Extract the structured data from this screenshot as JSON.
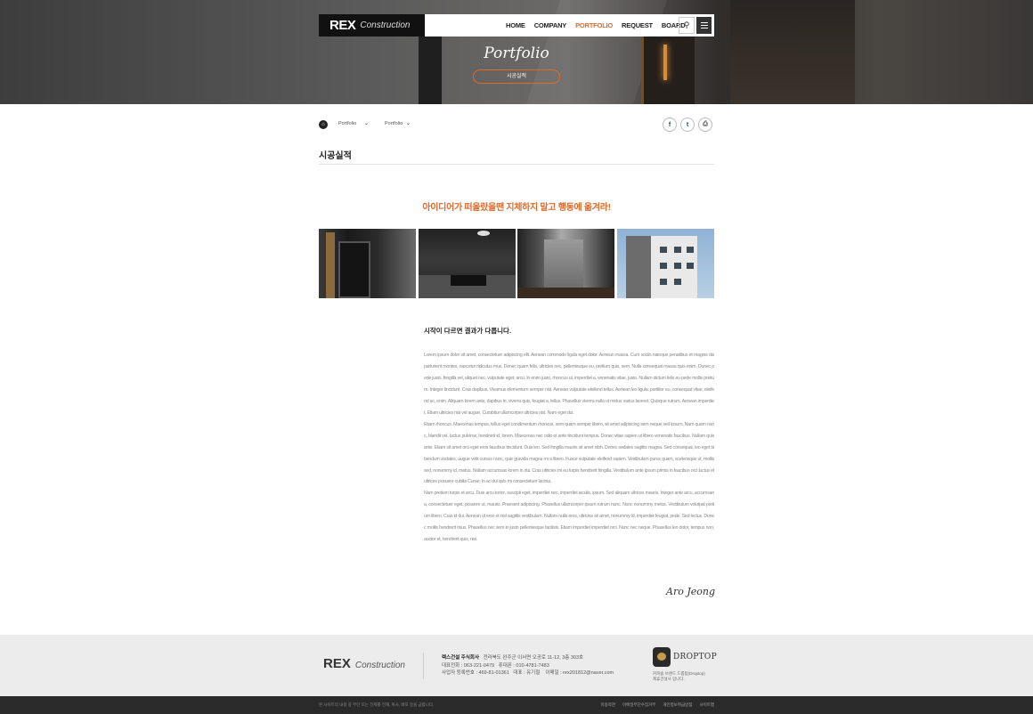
{
  "header": {
    "logo_main": "REX",
    "logo_sub": "Construction",
    "menu": [
      "HOME",
      "COMPANY",
      "PORTFOLIO",
      "REQUEST",
      "BOARD"
    ],
    "active_menu": "PORTFOLIO",
    "search_icon": "search-icon",
    "menu_icon": "hamburger-icon"
  },
  "hero": {
    "title": "Portfolio",
    "subtitle": "시공실적"
  },
  "breadcrumb": {
    "home_icon": "home-icon",
    "items": [
      "Portfolio",
      "Portfolio"
    ]
  },
  "share": {
    "facebook": "f",
    "twitter": "t",
    "print": "⎙"
  },
  "page": {
    "title": "시공실적",
    "slogan": "아이디어가 떠올랐을땐 지체하지 말고 행동에 옮겨라!"
  },
  "gallery": [
    {
      "icon": "interior-door-photo"
    },
    {
      "icon": "living-room-photo"
    },
    {
      "icon": "stone-wall-photo"
    },
    {
      "icon": "building-exterior-photo"
    }
  ],
  "article": {
    "heading": "시작이 다르면 결과가 다릅니다.",
    "paragraphs": [
      "Lorem ipsum dolor sit amet, consectetuer adipiscing elit. Aenean commodo ligula eget dolor. Aenean massa. Cum sociis natoque penatibus et magnis dis parturient montes, nascetur ridiculus mus. Donec quam felis, ultricies nec, pellentesque eu, pretium quis, sem. Nulla consequat massa quis enim. Donec pede justo, fringilla vel, aliquet nec, vulputate eget, arcu. In enim justo, rhoncus ut, imperdiet a, venenatis vitae, justo. Nullam dictum felis eu pede mollis pretium. Integer tincidunt. Cras dapibus. Vivamus elementum semper nisi. Aenean vulputate eleifend tellus. Aenean leo ligula, porttitor eu, consequat vitae, eleifend ac, enim. Aliquam lorem ante, dapibus in, viverra quis, feugiat a, tellus. Phasellus viverra nulla ut metus varius laoreet. Quisque rutrum. Aenean imperdiet. Etiam ultricies nisi vel augue. Curabitur ullamcorper ultricies nisi. Nam eget dui.",
      "Etiam rhoncus. Maecenas tempus, tellus eget condimentum rhoncus, sem quam semper libero, sit amet adipiscing sem neque sed ipsum. Nam quam nunc, blandit vel, luctus pulvinar, hendrerit id, lorem. Maecenas nec odio et ante tincidunt tempus. Donec vitae sapien ut libero venenatis faucibus. Nullam quis ante. Etiam sit amet orci eget eros faucibus tincidunt. Duis leo. Sed fringilla mauris sit amet nibh. Donec sodales sagittis magna. Sed consequat, leo eget bibendum sodales, augue velit cursus nunc, quis gravida magna mi a libero. Fusce vulputate eleifend sapien. Vestibulum purus quam, scelerisque ut, mollis sed, nonummy id, metus. Nullam accumsan lorem in dui. Cras ultricies mi eu turpis hendrerit fringilla. Vestibulum ante ipsum primis in faucibus orci luctus et ultrices posuere cubilia Curae; In ac dui quis mi consectetuer lacinia.",
      "Nam pretium turpis et arcu. Duis arcu tortor, suscipit eget, imperdiet nec, imperdiet iaculis, ipsum. Sed aliquam ultrices mauris. Integer ante arcu, accumsan a, consectetuer eget, posuere ut, mauris. Praesent adipiscing. Phasellus ullamcorper ipsum rutrum nunc. Nunc nonummy metus. Vestibulum volutpat pretium libero. Cras id dui. Aenean ut eros et nisl sagittis vestibulum. Nullam nulla eros, ultricies sit amet, nonummy id, imperdiet feugiat, pede. Sed lectus. Donec mollis hendrerit risus. Phasellus nec sem in justo pellentesque facilisis. Etiam imperdiet imperdiet orci. Nunc nec neque. Phasellus leo dolor, tempus non, auctor et, hendrerit quis, nisi."
    ],
    "signature": "Aro Jeong"
  },
  "footer": {
    "logo_main": "REX",
    "logo_sub": "Construction",
    "company": "렉스건설 주식회사",
    "address": "전라북도 완주군 이서면 오공로 11-12, 3층 303호",
    "phone": "대표전화 : 063-221-0479",
    "mobile": "휴대폰 : 010-4781-7483",
    "bizno": "사업자 등록번호 : 469-81-01361",
    "ceo": "대표 : 유기철",
    "email": "이메일 : rex201812@naver.com",
    "dp_name": "DROPTOP",
    "dp_desc_1": "커피숍 브랜드 드롭탑(Droptop)",
    "dp_desc_2": "제휴건설사 입니다."
  },
  "bottom": {
    "copyright": "본 사이트의 내용 중 무단 또는 전재를 전재, 복사, 배포 등을 금합니다.",
    "links": [
      "이용약관",
      "이메일무단수집거부",
      "개인정보취급방침",
      "사이트맵"
    ]
  }
}
